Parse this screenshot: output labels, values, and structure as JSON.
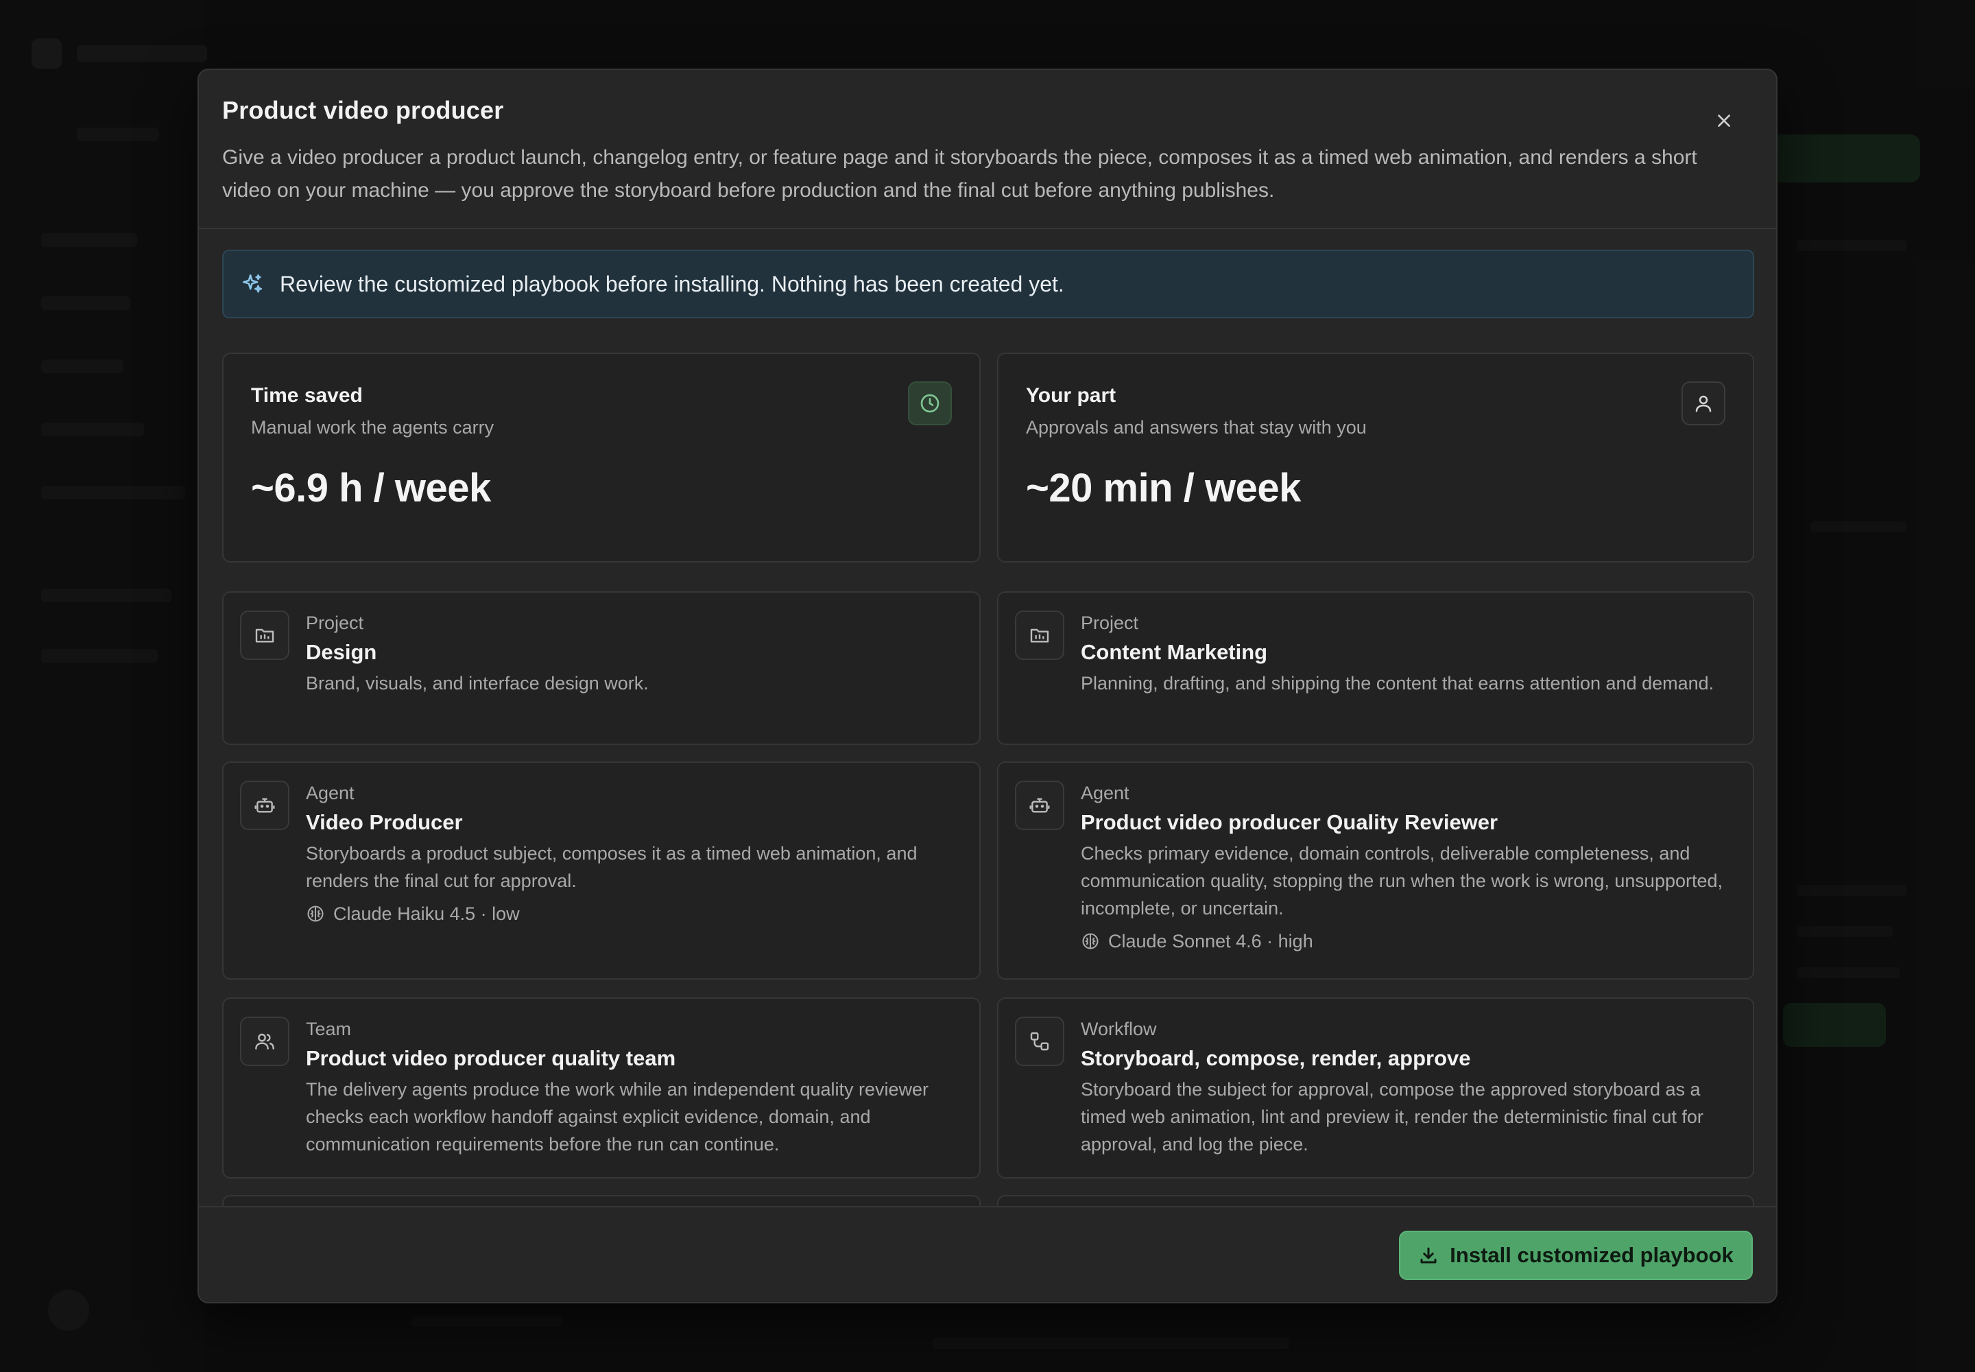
{
  "modal": {
    "title": "Product video producer",
    "description": "Give a video producer a product launch, changelog entry, or feature page and it storyboards the piece, composes it as a timed web animation, and renders a short video on your machine — you approve the storyboard before production and the final cut before anything publishes.",
    "close_icon": "close-icon"
  },
  "notice": {
    "icon": "sparkle-icon",
    "text": "Review the customized playbook before installing. Nothing has been created yet."
  },
  "stats": [
    {
      "label": "Time saved",
      "sub": "Manual work the agents carry",
      "value": "~6.9 h / week",
      "icon": "clock-icon"
    },
    {
      "label": "Your part",
      "sub": "Approvals and answers that stay with you",
      "value": "~20 min / week",
      "icon": "user-icon"
    }
  ],
  "items": [
    {
      "kind": "Project",
      "title": "Design",
      "desc": "Brand, visuals, and interface design work.",
      "icon": "folder-icon"
    },
    {
      "kind": "Project",
      "title": "Content Marketing",
      "desc": "Planning, drafting, and shipping the content that earns attention and demand.",
      "icon": "folder-icon"
    },
    {
      "kind": "Agent",
      "title": "Video Producer",
      "desc": "Storyboards a product subject, composes it as a timed web animation, and renders the final cut for approval.",
      "model": "Claude Haiku 4.5 · low",
      "icon": "bot-icon"
    },
    {
      "kind": "Agent",
      "title": "Product video producer Quality Reviewer",
      "desc": "Checks primary evidence, domain controls, deliverable completeness, and communication quality, stopping the run when the work is wrong, unsupported, incomplete, or uncertain.",
      "model": "Claude Sonnet 4.6 · high",
      "icon": "bot-icon"
    },
    {
      "kind": "Team",
      "title": "Product video producer quality team",
      "desc": "The delivery agents produce the work while an independent quality reviewer checks each workflow handoff against explicit evidence, domain, and communication requirements before the run can continue.",
      "icon": "users-icon"
    },
    {
      "kind": "Workflow",
      "title": "Storyboard, compose, render, approve",
      "desc": "Storyboard the subject for approval, compose the approved storyboard as a timed web animation, lint and preview it, render the deterministic final cut for approval, and log the piece.",
      "icon": "workflow-icon"
    }
  ],
  "footer": {
    "install_label": "Install customized playbook",
    "install_icon": "download-icon"
  },
  "colors": {
    "accent_green": "#4fa469",
    "notice_bg": "#22323c",
    "modal_bg": "#262626"
  }
}
